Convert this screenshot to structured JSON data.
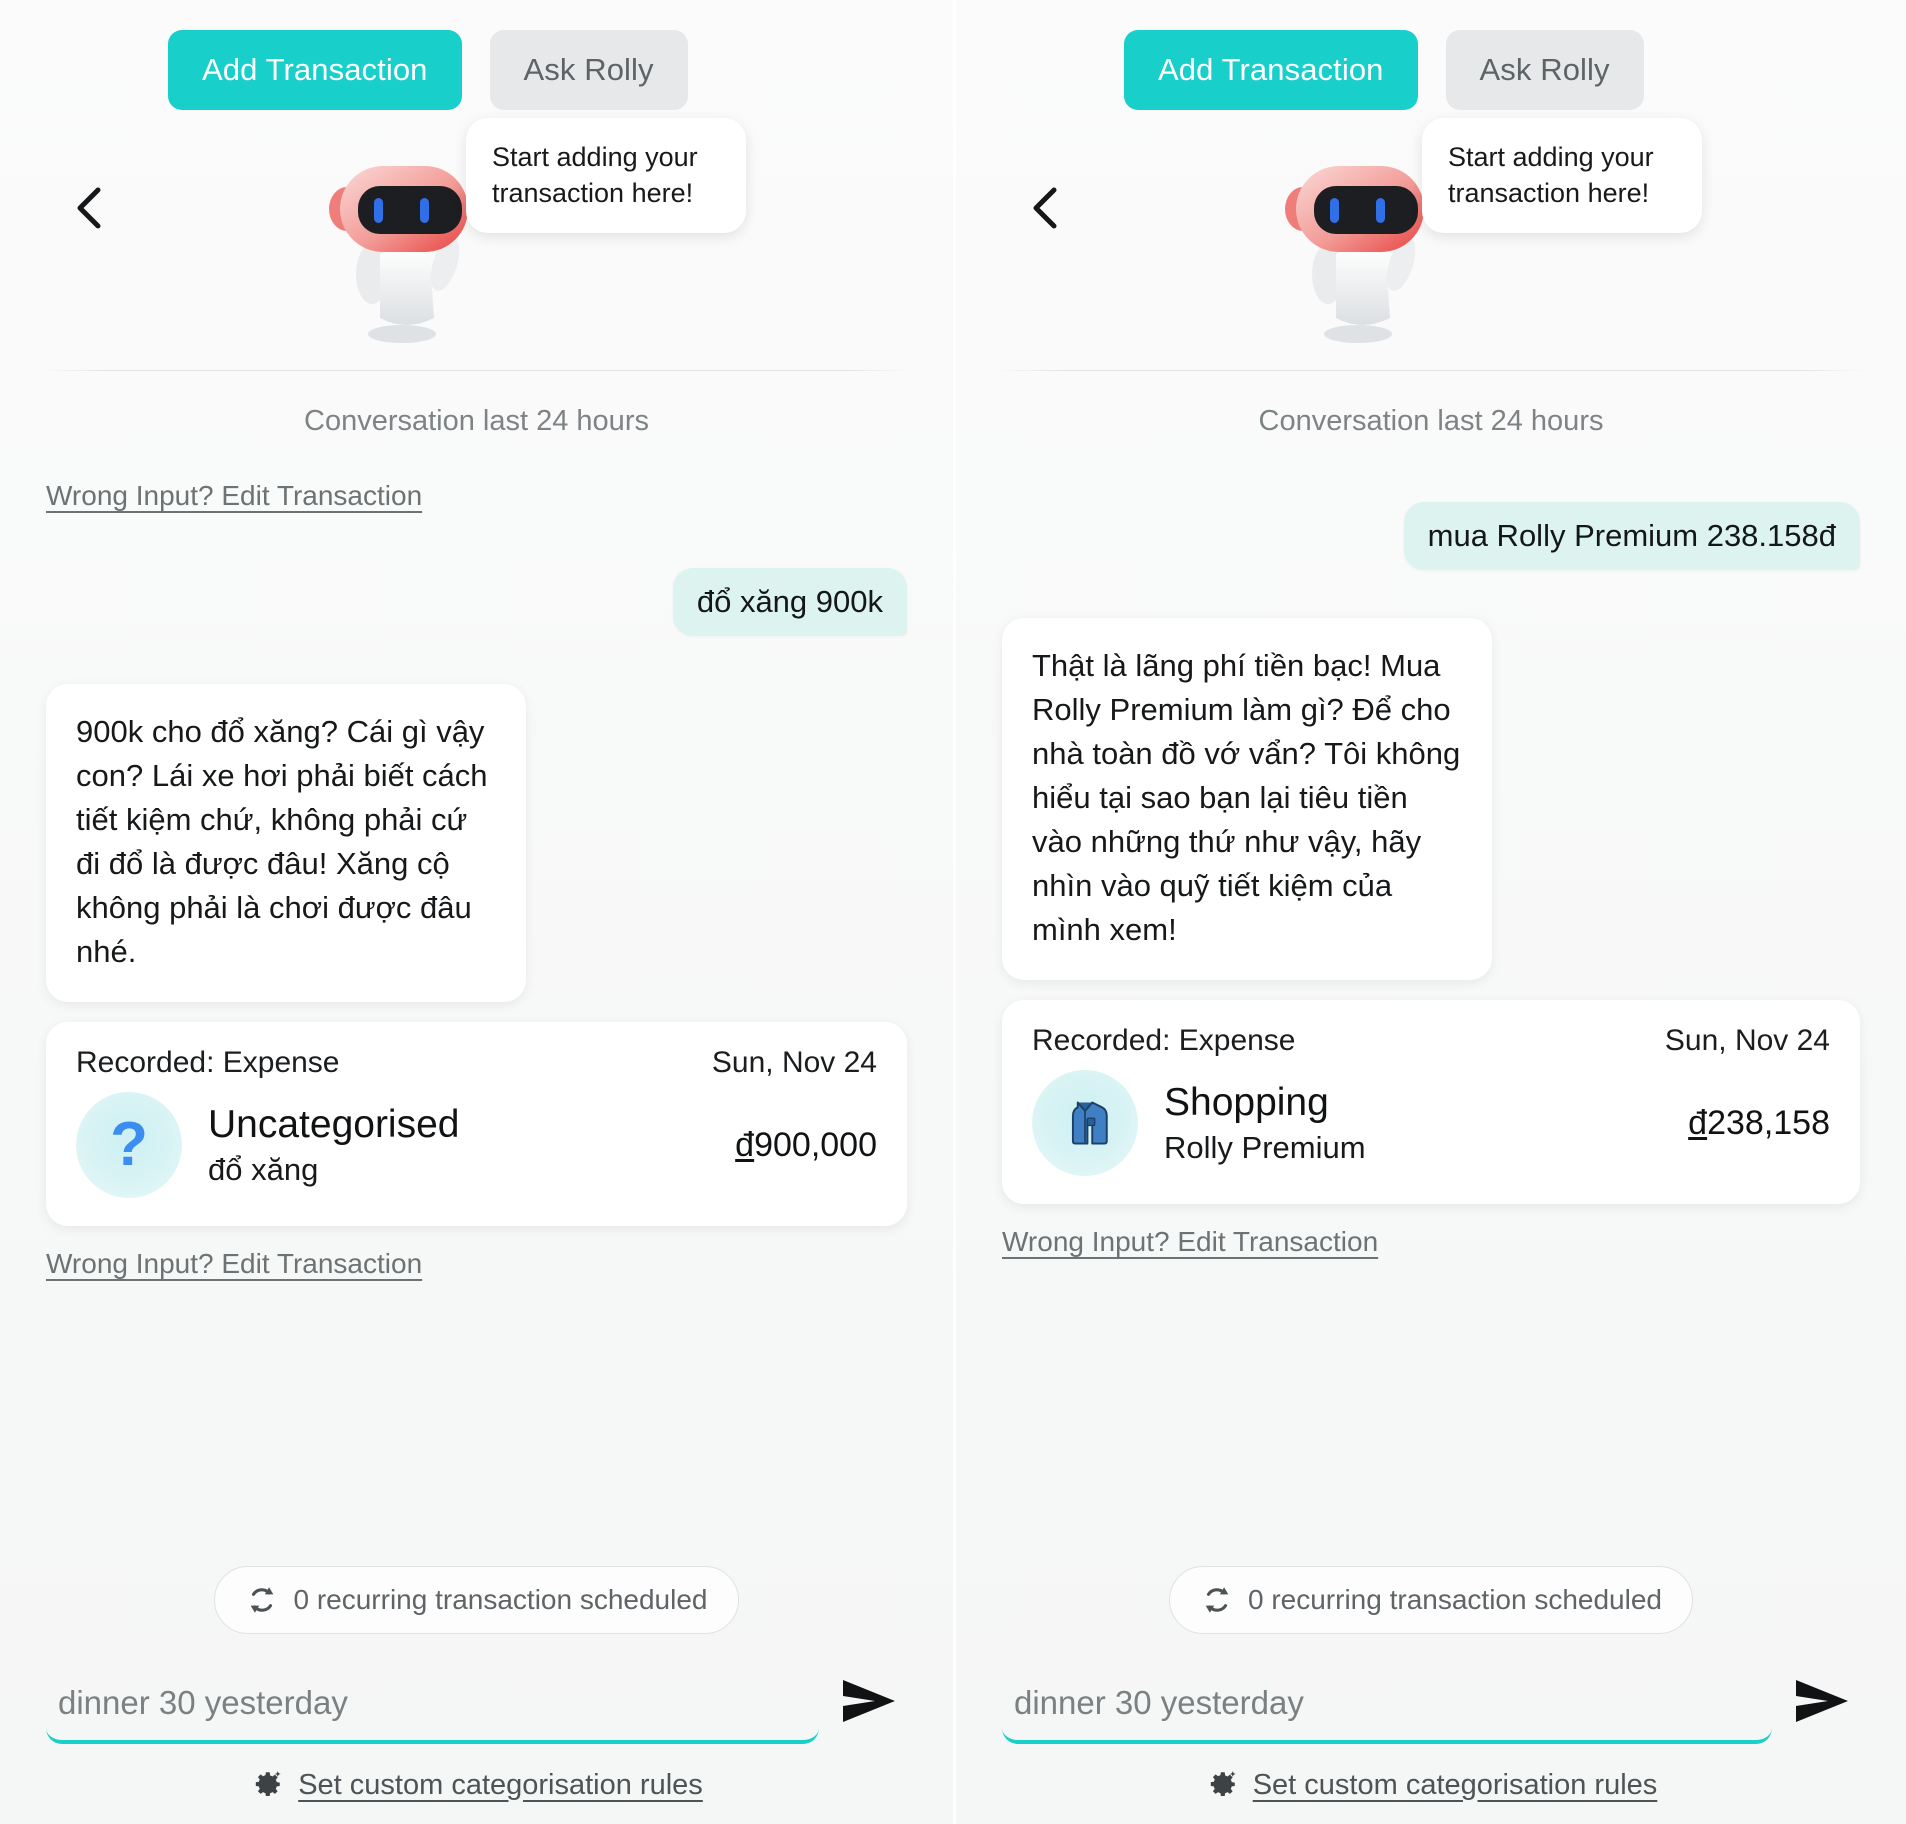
{
  "panels": [
    {
      "tabs": {
        "primary": "Add Transaction",
        "secondary": "Ask Rolly"
      },
      "back_icon": "chevron-left-icon",
      "mascot": "rolly-robot-mascot",
      "speech_bubble": "Start adding your transaction here!",
      "conversation_label": "Conversation last 24 hours",
      "edit_link_top": "Wrong Input? Edit Transaction",
      "user_message": "đổ xăng 900k",
      "bot_message": "900k cho đổ xăng? Cái gì vậy con? Lái xe hơi phải biết cách tiết kiệm chứ, không phải cứ đi đổ là được đâu! Xăng cộ không phải là chơi được đâu nhé.",
      "transaction": {
        "recorded_label": "Recorded: Expense",
        "date": "Sun, Nov 24",
        "category_icon": "question-mark-icon",
        "category": "Uncategorised",
        "note": "đổ xăng",
        "currency_symbol": "đ",
        "amount": "900,000"
      },
      "edit_link_bottom": "Wrong Input? Edit Transaction",
      "recurring": {
        "icon": "refresh-icon",
        "label": "0 recurring transaction scheduled"
      },
      "input": {
        "placeholder": "dinner 30 yesterday",
        "value": "",
        "send_icon": "send-arrow-icon"
      },
      "rules": {
        "icon": "gear-sparkle-icon",
        "label": "Set custom categorisation rules"
      }
    },
    {
      "tabs": {
        "primary": "Add Transaction",
        "secondary": "Ask Rolly"
      },
      "back_icon": "chevron-left-icon",
      "mascot": "rolly-robot-mascot",
      "speech_bubble": "Start adding your transaction here!",
      "conversation_label": "Conversation last 24 hours",
      "edit_link_top": "",
      "user_message": "mua Rolly Premium 238.158đ",
      "bot_message": "Thật là lãng phí tiền bạc! Mua Rolly Premium làm gì? Để cho nhà toàn đồ vớ vẩn? Tôi không hiểu tại sao bạn lại tiêu tiền vào những thứ như vậy, hãy nhìn vào quỹ tiết kiệm của mình xem!",
      "transaction": {
        "recorded_label": "Recorded: Expense",
        "date": "Sun, Nov 24",
        "category_icon": "jacket-icon",
        "category": "Shopping",
        "note": "Rolly Premium",
        "currency_symbol": "đ",
        "amount": "238,158"
      },
      "edit_link_bottom": "Wrong Input? Edit Transaction",
      "recurring": {
        "icon": "refresh-icon",
        "label": "0 recurring transaction scheduled"
      },
      "input": {
        "placeholder": "dinner 30 yesterday",
        "value": "",
        "send_icon": "send-arrow-icon"
      },
      "rules": {
        "icon": "gear-sparkle-icon",
        "label": "Set custom categorisation rules"
      }
    }
  ],
  "colors": {
    "accent_teal": "#18cfc9",
    "user_bubble": "#dcf3ef",
    "inactive_tab": "#e6e8ea",
    "avatar_blue": "#3b8ef0"
  }
}
